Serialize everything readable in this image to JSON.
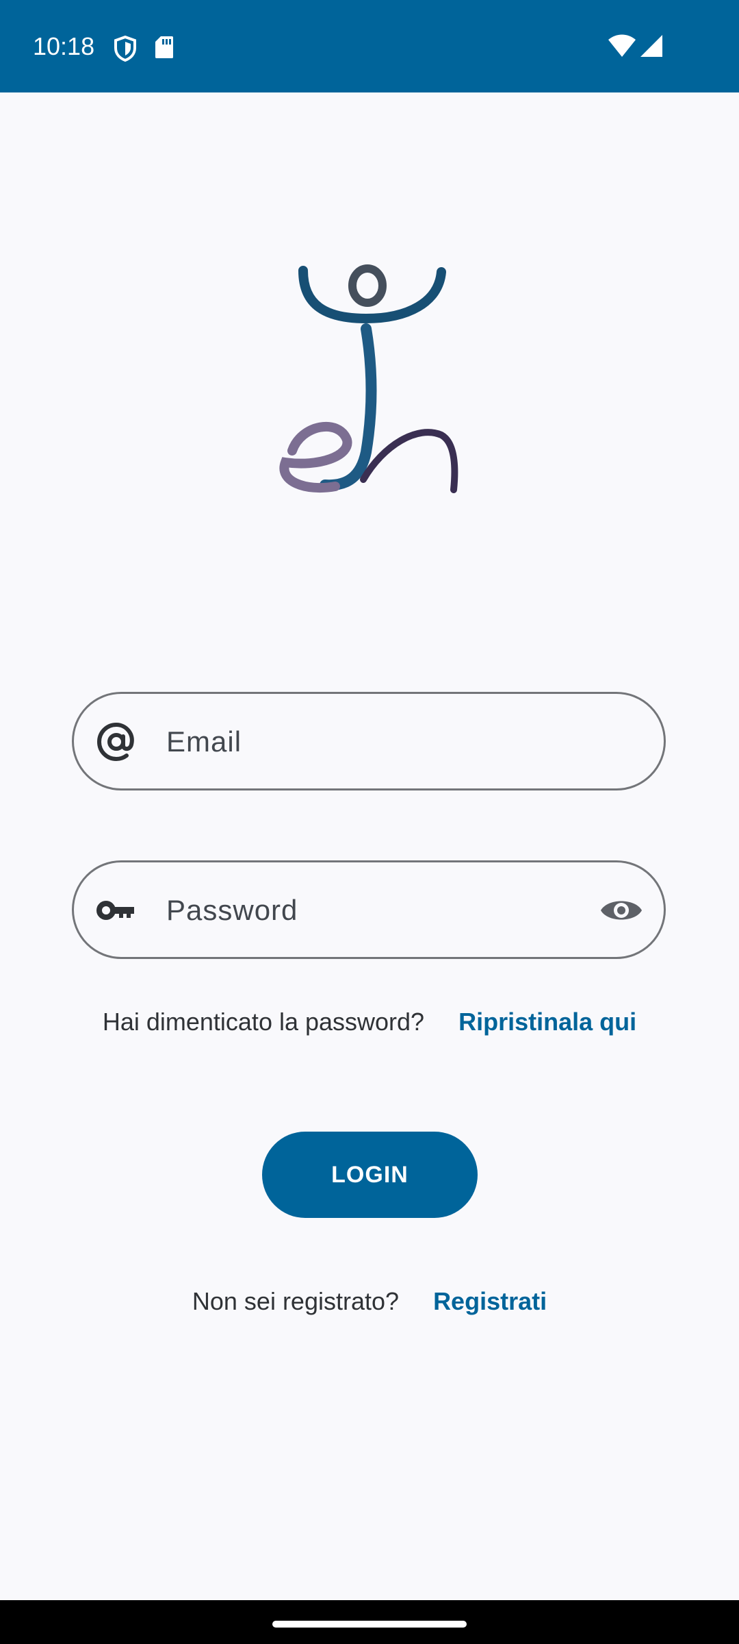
{
  "status_bar": {
    "time": "10:18",
    "icons": [
      "shield-icon",
      "sd-card-icon",
      "wifi-icon",
      "cell-signal-icon"
    ]
  },
  "logo": {
    "name": "app-logo"
  },
  "email_field": {
    "placeholder": "Email",
    "value": "",
    "icon": "at-sign-icon"
  },
  "password_field": {
    "placeholder": "Password",
    "value": "",
    "icon": "key-icon",
    "toggle_icon": "eye-icon"
  },
  "forgot": {
    "text": "Hai dimenticato la password?",
    "link": "Ripristinala qui"
  },
  "login_button": {
    "label": "LOGIN"
  },
  "register": {
    "text": "Non sei registrato?",
    "link": "Registrati"
  },
  "colors": {
    "primary": "#00649a",
    "background": "#f9f9fc",
    "outline": "#737579",
    "text": "#2f3236"
  }
}
